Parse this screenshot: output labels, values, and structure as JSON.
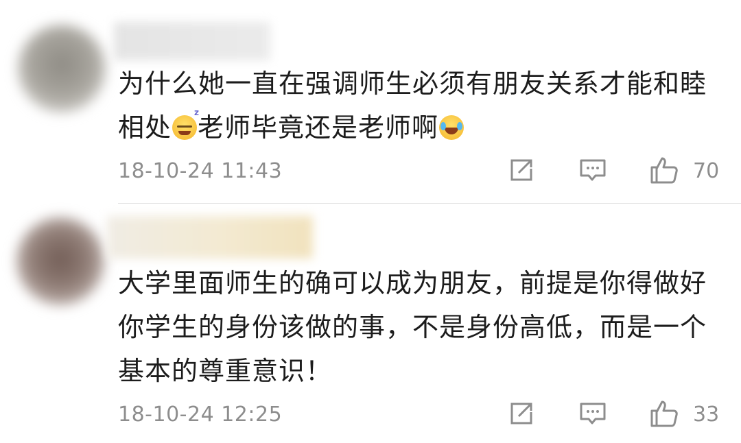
{
  "comments": [
    {
      "text_part1": "为什么她一直在强调师生必须有朋友关系才能和睦相处",
      "emoji1": "sleepy-emoji-icon",
      "text_part2": "老师毕竟还是老师啊",
      "emoji2": "laughing-tears-emoji-icon",
      "timestamp": "18-10-24 11:43",
      "like_count": "70"
    },
    {
      "text": "大学里面师生的确可以成为朋友，前提是你得做好你学生的身份该做的事，不是身份高低，而是一个基本的尊重意识！",
      "timestamp": "18-10-24 12:25",
      "like_count": "33"
    }
  ],
  "icons": {
    "share": "share-icon",
    "reply": "comment-icon",
    "like": "thumbs-up-icon"
  },
  "colors": {
    "text": "#1c1c1c",
    "meta": "#8d8d8d",
    "divider": "#e2e2e2"
  }
}
